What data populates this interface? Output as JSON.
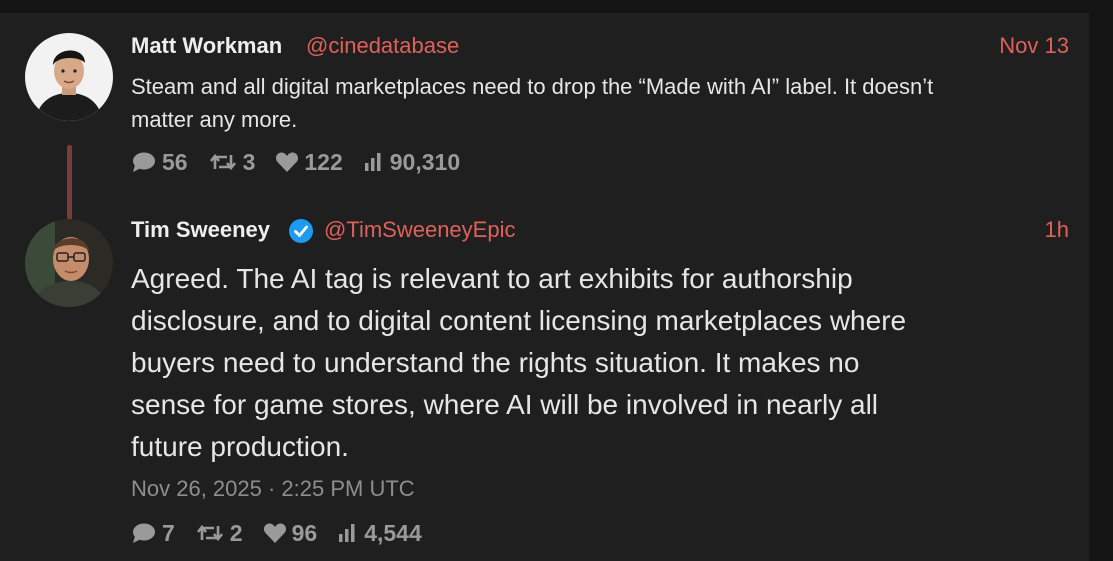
{
  "tweets": [
    {
      "name": "Matt Workman",
      "handle": "@cinedatabase",
      "time": "Nov 13",
      "text_line1": "Steam and all digital marketplaces need to drop the “Made with AI” label.  It doesn’t",
      "text_line2": "matter any more.",
      "replies": "56",
      "retweets": "3",
      "likes": "122",
      "views": "90,310"
    },
    {
      "name": "Tim Sweeney",
      "handle": "@TimSweeneyEpic",
      "time": "1h",
      "text_lines": [
        "Agreed. The AI tag is relevant to art exhibits for authorship",
        "disclosure, and to digital content licensing marketplaces where",
        "buyers need to understand the rights situation. It makes no",
        "sense for game stores, where AI will be involved in nearly all",
        "future production."
      ],
      "date": "Nov 26, 2025 · 2:25 PM UTC",
      "replies": "7",
      "retweets": "2",
      "likes": "96",
      "views": "4,544"
    }
  ],
  "colors": {
    "background": "#141414",
    "panel": "#1f1f1f",
    "accent": "#e0605a",
    "verified": "#1d9bf0",
    "thread_line": "#7a3b3b",
    "muted": "#9a9a9a"
  }
}
